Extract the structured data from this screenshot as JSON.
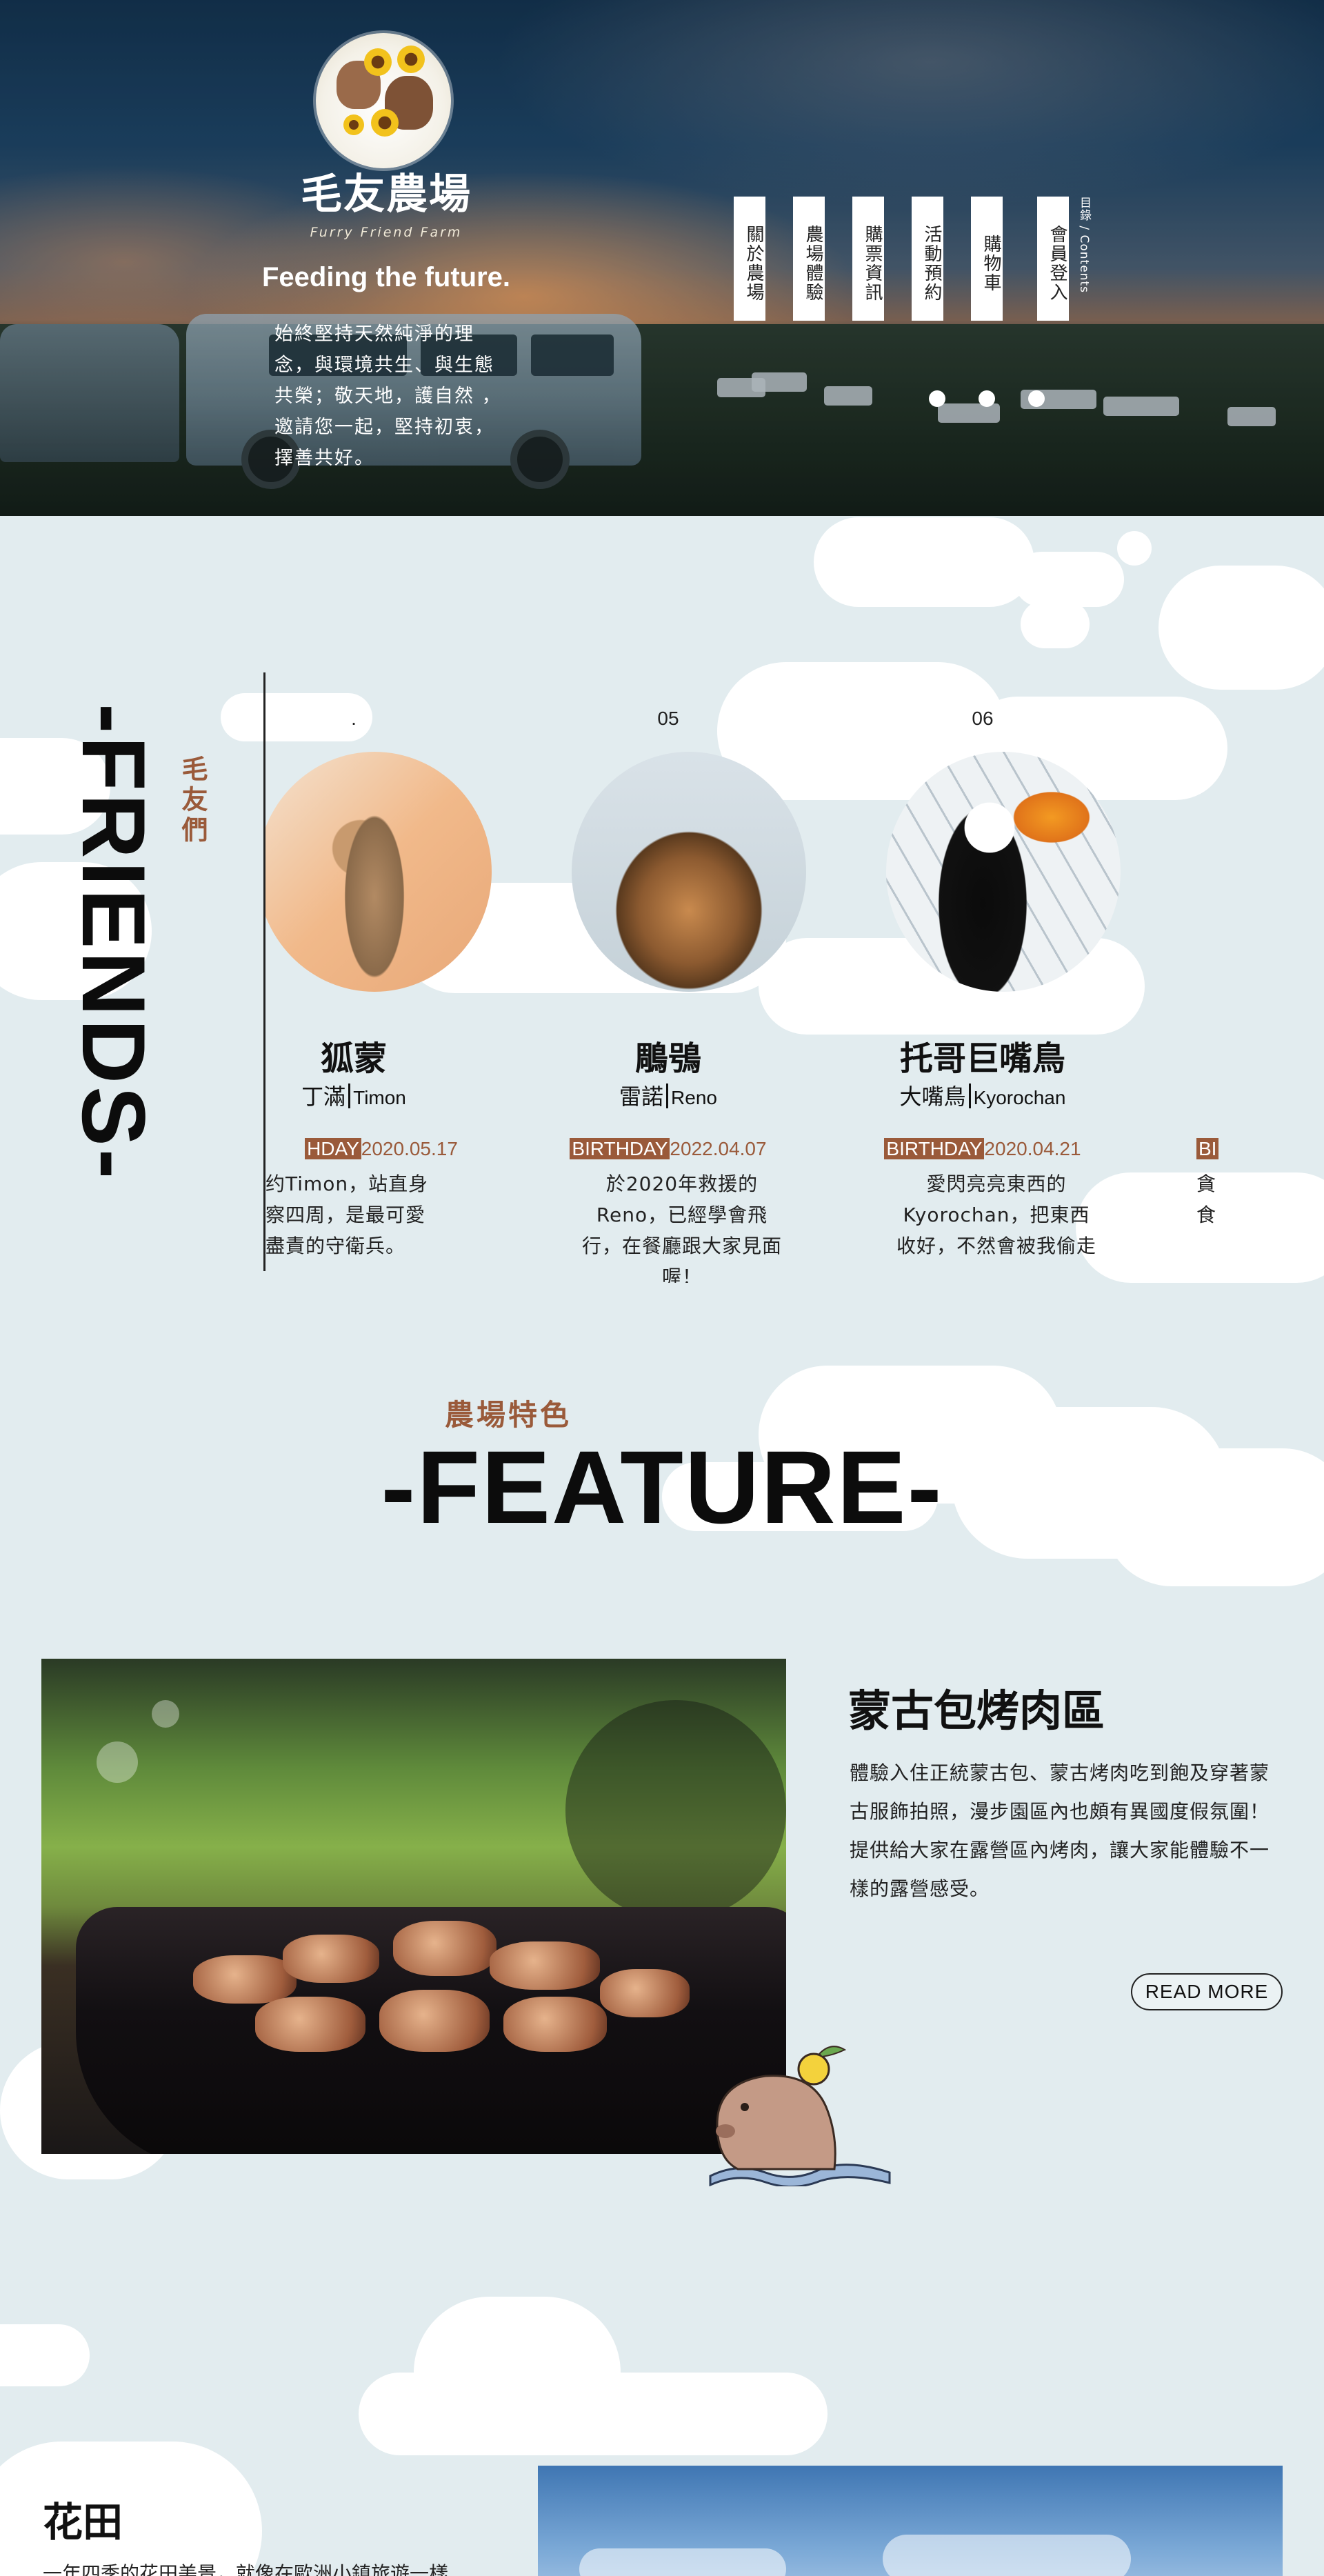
{
  "brand": {
    "name": "毛友農場",
    "name_en": "Furry Friend Farm",
    "tagline": "Feeding the future.",
    "intro": "始終堅持天然純淨的理念，與環境共生、與生態共榮；敬天地，護自然 ，邀請您一起，堅持初衷，擇善共好。"
  },
  "nav": {
    "items": [
      {
        "label": "關於農場"
      },
      {
        "label": "農場體驗"
      },
      {
        "label": "購票資訊"
      },
      {
        "label": "活動預約"
      },
      {
        "label": "購物車"
      },
      {
        "label": "會員登入"
      }
    ],
    "contents_label": "目錄 / Contents"
  },
  "hero": {
    "slide_count": 3,
    "active_slide": 1
  },
  "friends": {
    "title": "-FRIENDS-",
    "subtitle": "毛友們",
    "cards": [
      {
        "num": ".",
        "name": "狐蒙",
        "name_zh2": "丁滿",
        "name_en": "Timon",
        "birthday_label": "HDAY",
        "birthday": "2020.05.17",
        "desc": "约Timon，站直身察四周，是最可愛盡責的守衛兵。"
      },
      {
        "num": "05",
        "name": "鵰鴞",
        "name_zh2": "雷諾",
        "name_en": "Reno",
        "birthday_label": "BIRTHDAY",
        "birthday": "2022.04.07",
        "desc": "於2020年救援的Reno，已經學會飛行，在餐廳跟大家見面喔！"
      },
      {
        "num": "06",
        "name": "托哥巨嘴鳥",
        "name_zh2": "大嘴鳥",
        "name_en": "Kyorochan",
        "birthday_label": "BIRTHDAY",
        "birthday": "2020.04.21",
        "desc": "愛閃亮亮東西的Kyorochan，把東西收好，不然會被我偷走"
      },
      {
        "num": "",
        "name": "",
        "name_zh2": "",
        "name_en": "",
        "birthday_label": "BI",
        "birthday": "",
        "desc": "貪食"
      }
    ]
  },
  "feature": {
    "subtitle": "農場特色",
    "title": "-FEATURE-",
    "items": [
      {
        "title": "蒙古包烤肉區",
        "desc": "體驗入住正統蒙古包、蒙古烤肉吃到飽及穿著蒙古服飾拍照，漫步園區內也頗有異國度假氛圍！提供給大家在露營區內烤肉，讓大家能體驗不一樣的露營感受。",
        "button": "READ MORE"
      },
      {
        "title": "花田",
        "desc": "一年四季的花田美景，就像在歐洲小鎮旅遊一樣……"
      }
    ]
  },
  "colors": {
    "accent": "#9a5a3a",
    "background": "#e2ecef",
    "text": "#111111"
  }
}
